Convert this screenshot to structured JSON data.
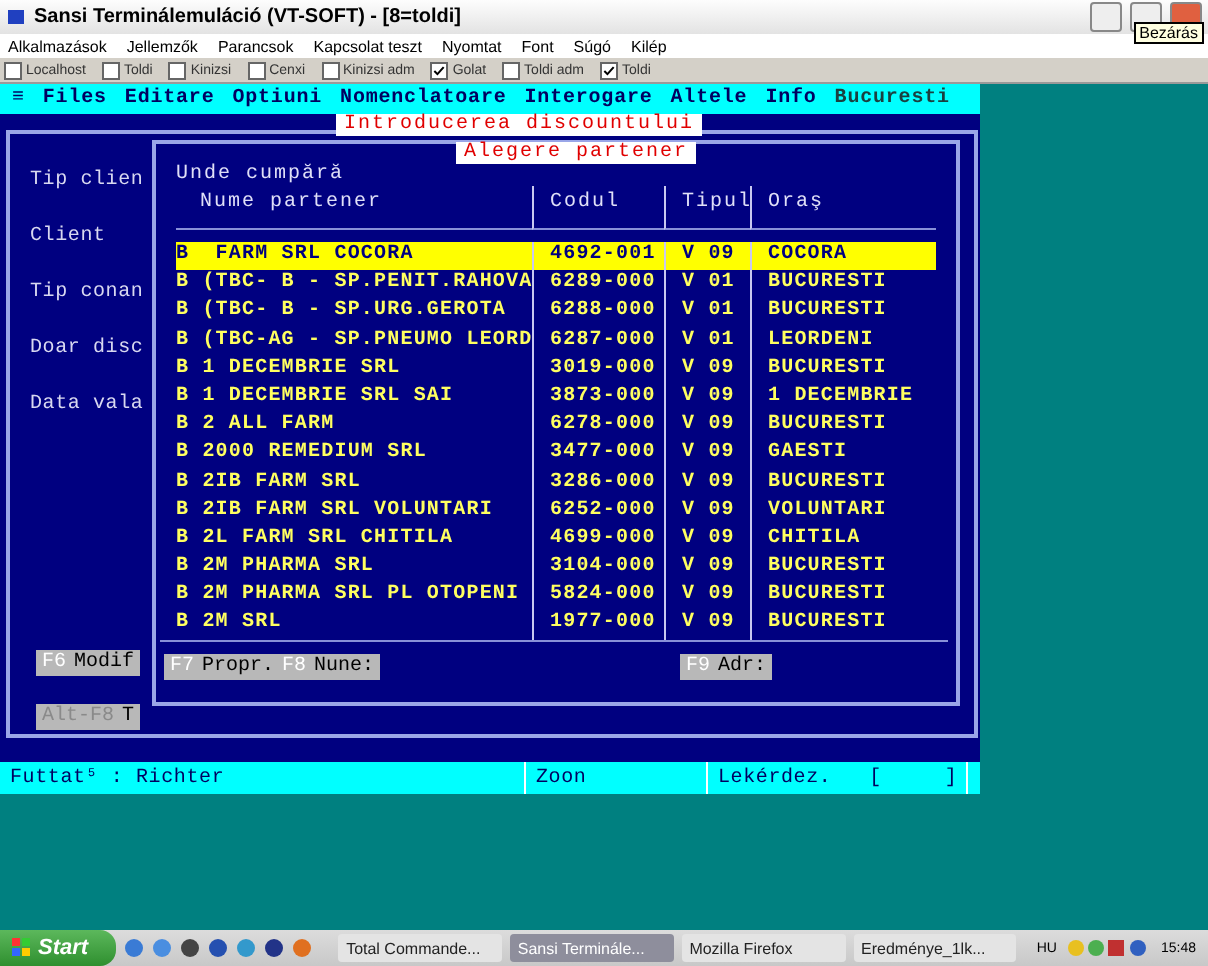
{
  "window": {
    "title": "Sansi Terminálemuláció (VT-SOFT) - [8=toldi]",
    "tooltip": "Bezárás"
  },
  "menu": [
    "Alkalmazások",
    "Jellemzők",
    "Parancsok",
    "Kapcsolat teszt",
    "Nyomtat",
    "Font",
    "Súgó",
    "Kilép"
  ],
  "hosts": [
    {
      "label": "Localhost",
      "checked": false
    },
    {
      "label": "Toldi",
      "checked": false
    },
    {
      "label": "Kinizsi",
      "checked": false
    },
    {
      "label": "Cenxi",
      "checked": false
    },
    {
      "label": "Kinizsi adm",
      "checked": false
    },
    {
      "label": "Golat",
      "checked": true
    },
    {
      "label": "Toldi adm",
      "checked": false
    },
    {
      "label": "Toldi",
      "checked": true
    }
  ],
  "terminal": {
    "menu": [
      "≡",
      "Files",
      "Editare",
      "Optiuni",
      "Nomenclatoare",
      "Interogare",
      "Altele",
      "Info",
      "Bucuresti"
    ],
    "discount_dialog": {
      "title": "Introducerea discountului",
      "labels": [
        "Tip clien",
        "Client",
        "Tip conan",
        "Doar disc",
        "Data vala"
      ],
      "buttons": [
        {
          "key": "F6",
          "label": "Modif",
          "disabled": false
        },
        {
          "key": "Alt-F8",
          "label": "T",
          "disabled": true
        }
      ]
    },
    "partner_dialog": {
      "title": "Alegere partener",
      "heading": "Unde cumpără",
      "columns": [
        "Nume partener",
        "Codul",
        "Tipul",
        "Oraş"
      ],
      "rows": [
        {
          "name": "B  FARM SRL COCORA",
          "code": "4692-001",
          "type": "V 09",
          "city": "COCORA",
          "selected": true
        },
        {
          "name": "B (TBC- B - SP.PENIT.RAHOVA",
          "code": "6289-000",
          "type": "V 01",
          "city": "BUCURESTI",
          "selected": false
        },
        {
          "name": "B (TBC- B - SP.URG.GEROTA",
          "code": "6288-000",
          "type": "V 01",
          "city": "BUCURESTI",
          "selected": false
        },
        {
          "name": "B (TBC-AG - SP.PNEUMO LEORD",
          "code": "6287-000",
          "type": "V 01",
          "city": "LEORDENI",
          "selected": false
        },
        {
          "name": "B 1 DECEMBRIE SRL",
          "code": "3019-000",
          "type": "V 09",
          "city": "BUCURESTI",
          "selected": false
        },
        {
          "name": "B 1 DECEMBRIE SRL SAI",
          "code": "3873-000",
          "type": "V 09",
          "city": "1 DECEMBRIE",
          "selected": false
        },
        {
          "name": "B 2 ALL FARM",
          "code": "6278-000",
          "type": "V 09",
          "city": "BUCURESTI",
          "selected": false
        },
        {
          "name": "B 2000 REMEDIUM SRL",
          "code": "3477-000",
          "type": "V 09",
          "city": "GAESTI",
          "selected": false
        },
        {
          "name": "B 2IB FARM SRL",
          "code": "3286-000",
          "type": "V 09",
          "city": "BUCURESTI",
          "selected": false
        },
        {
          "name": "B 2IB FARM SRL VOLUNTARI",
          "code": "6252-000",
          "type": "V 09",
          "city": "VOLUNTARI",
          "selected": false
        },
        {
          "name": "B 2L FARM SRL CHITILA",
          "code": "4699-000",
          "type": "V 09",
          "city": "CHITILA",
          "selected": false
        },
        {
          "name": "B 2M PHARMA SRL",
          "code": "3104-000",
          "type": "V 09",
          "city": "BUCURESTI",
          "selected": false
        },
        {
          "name": "B 2M PHARMA SRL PL OTOPENI",
          "code": "5824-000",
          "type": "V 09",
          "city": "BUCURESTI",
          "selected": false
        },
        {
          "name": "B 2M SRL",
          "code": "1977-000",
          "type": "V 09",
          "city": "BUCURESTI",
          "selected": false
        }
      ],
      "buttons": [
        {
          "keys": [
            {
              "key": "F7",
              "label": "Propr."
            },
            {
              "key": "F8",
              "label": "Nune:"
            }
          ]
        },
        {
          "keys": [
            {
              "key": "F9",
              "label": "Adr:"
            }
          ]
        }
      ]
    },
    "status_bar": [
      "Futtat⁵ : Richter",
      "Zoon",
      "Lekérdez.   [     ]"
    ]
  },
  "taskbar": {
    "start": "Start",
    "tasks": [
      {
        "label": "Total Commande...",
        "selected": false
      },
      {
        "label": "Sansi Terminále...",
        "selected": true
      },
      {
        "label": "Mozilla Firefox",
        "selected": false
      },
      {
        "label": "Eredménye_1lk...",
        "selected": false
      }
    ],
    "language": "HU",
    "clock": "15:48"
  }
}
